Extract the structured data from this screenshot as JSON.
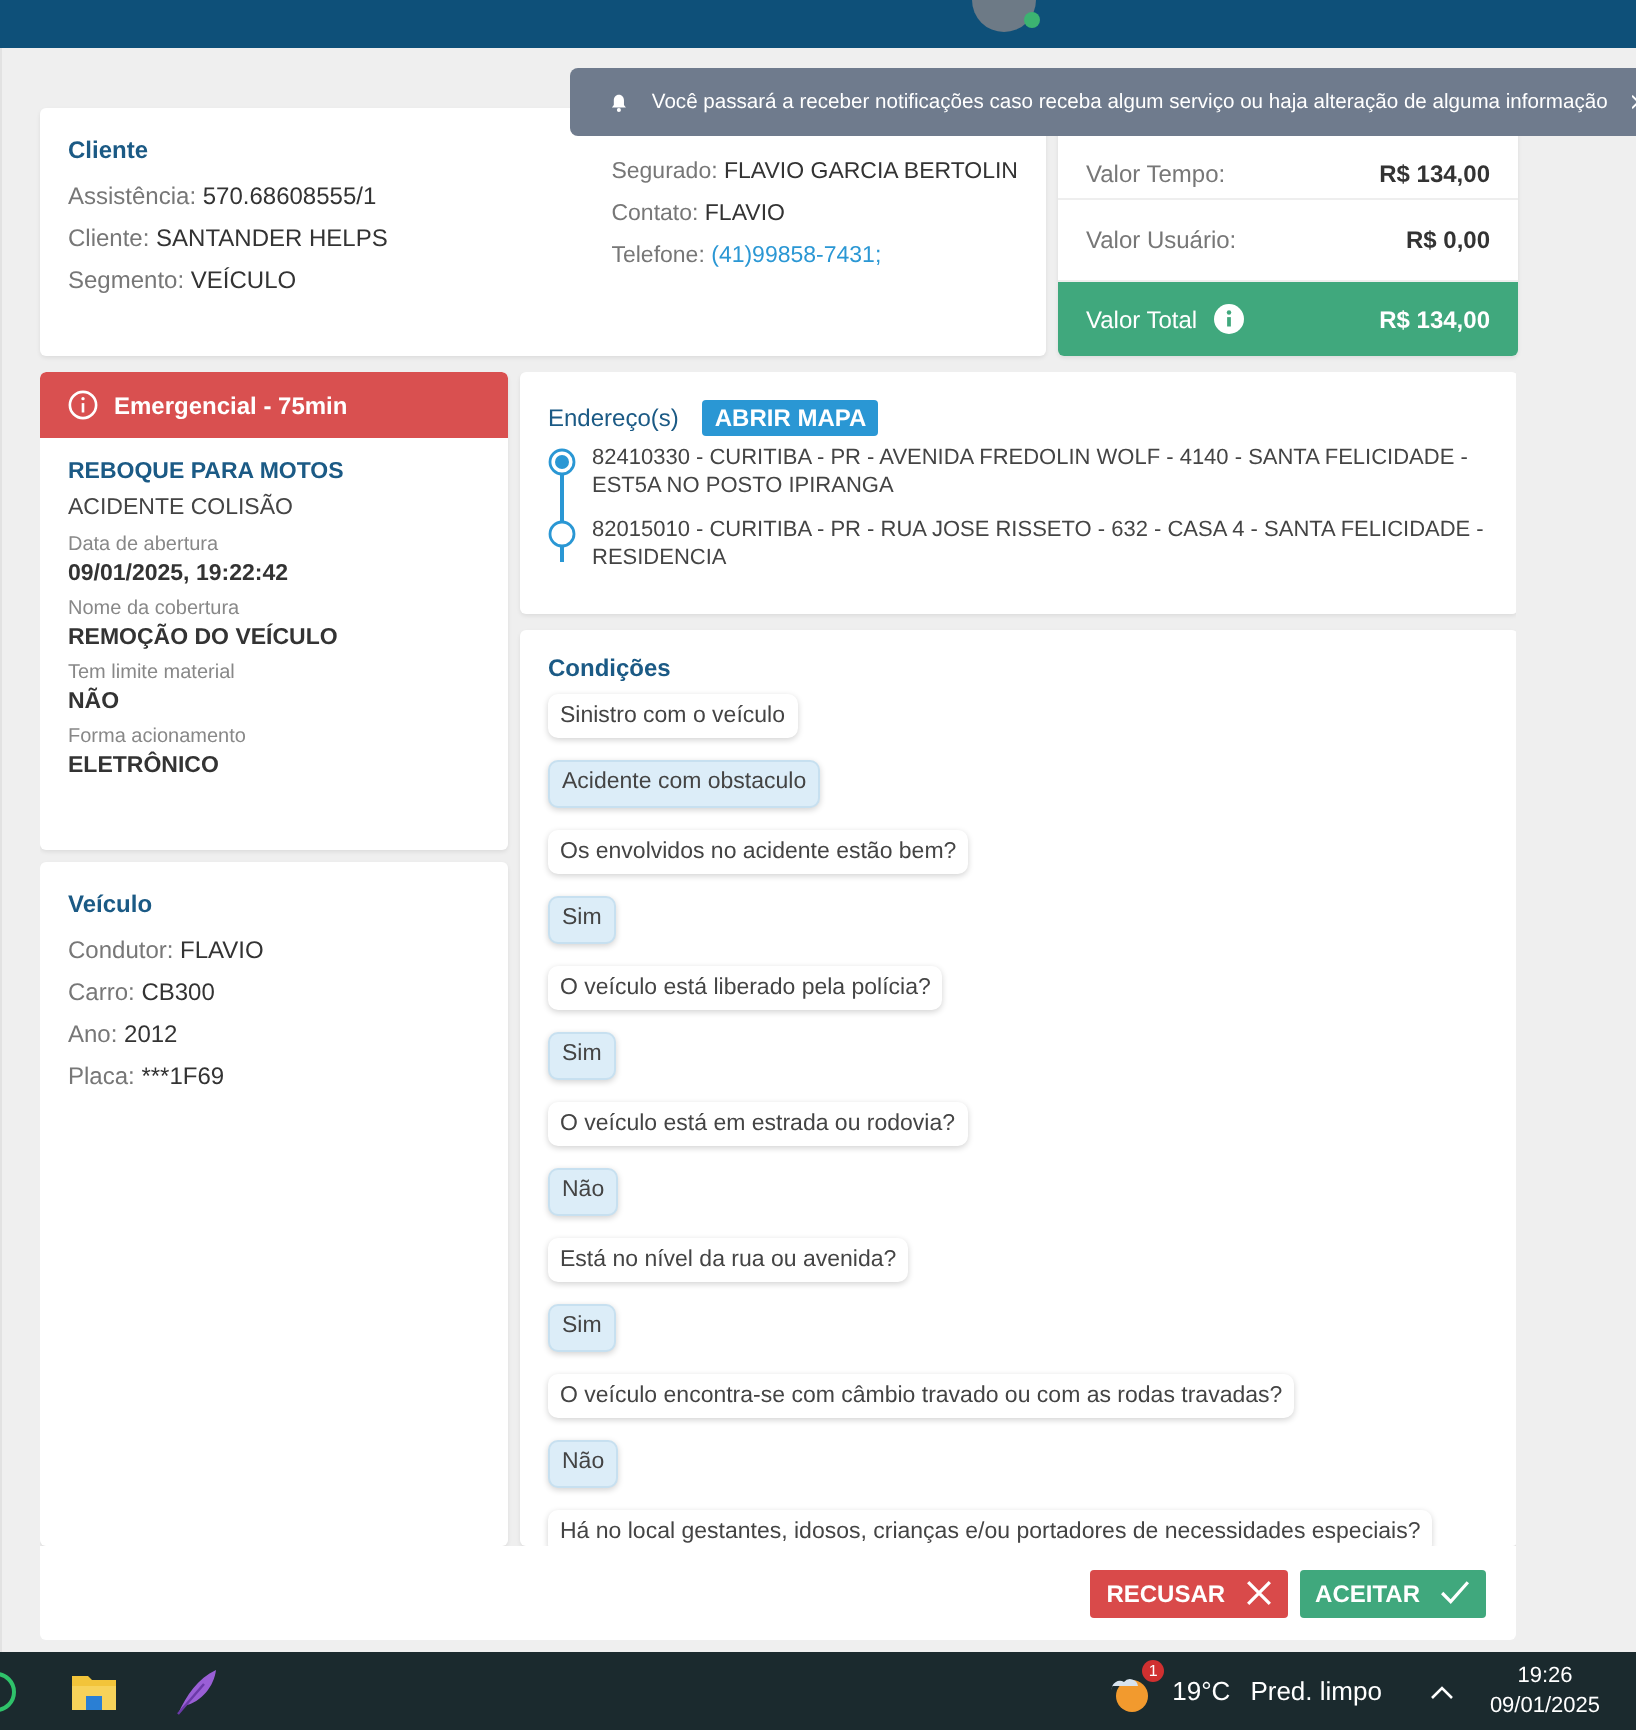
{
  "toast": {
    "message": "Você passará a receber notificações caso receba algum serviço ou haja alteração de alguma informação"
  },
  "client": {
    "title": "Cliente",
    "fields_left": [
      {
        "label": "Assistência:",
        "value": "570.68608555/1",
        "kind": "text"
      },
      {
        "label": "Cliente:",
        "value": "SANTANDER HELPS",
        "kind": "text"
      },
      {
        "label": "Segmento:",
        "value": "VEÍCULO",
        "kind": "text"
      }
    ],
    "fields_right": [
      {
        "label": "Segurado:",
        "value": "FLAVIO GARCIA BERTOLIN",
        "kind": "text"
      },
      {
        "label": "Contato:",
        "value": "FLAVIO",
        "kind": "text"
      },
      {
        "label": "Telefone:",
        "value": "(41)99858-7431;",
        "kind": "link"
      }
    ]
  },
  "values": {
    "rows": [
      {
        "label": "Valor Tempo:",
        "value": "R$ 134,00"
      },
      {
        "label": "Valor Usuário:",
        "value": "R$ 0,00"
      }
    ],
    "total": {
      "label": "Valor Total",
      "value": "R$ 134,00"
    }
  },
  "service": {
    "badge": "Emergencial - 75min",
    "title": "REBOQUE PARA MOTOS",
    "subtitle": "ACIDENTE COLISÃO",
    "details": [
      {
        "label": "Data de abertura",
        "value": "09/01/2025, 19:22:42"
      },
      {
        "label": "Nome da cobertura",
        "value": "REMOÇÃO DO VEÍCULO"
      },
      {
        "label": "Tem limite material",
        "value": "NÃO"
      },
      {
        "label": "Forma acionamento",
        "value": "ELETRÔNICO"
      }
    ]
  },
  "vehicle": {
    "title": "Veículo",
    "fields": [
      {
        "label": "Condutor:",
        "value": "FLAVIO"
      },
      {
        "label": "Carro:",
        "value": "CB300"
      },
      {
        "label": "Ano:",
        "value": "2012"
      },
      {
        "label": "Placa:",
        "value": "***1F69"
      }
    ]
  },
  "addresses": {
    "title": "Endereço(s)",
    "map_button": "ABRIR MAPA",
    "items": [
      {
        "text": "82410330 - CURITIBA - PR - AVENIDA FREDOLIN WOLF - 4140 - SANTA FELICIDADE - EST5A NO POSTO IPIRANGA",
        "kind": "origin"
      },
      {
        "text": "82015010 - CURITIBA - PR - RUA JOSE RISSETO - 632 - CASA 4 - SANTA FELICIDADE - RESIDENCIA",
        "kind": "destination"
      }
    ]
  },
  "conditions": {
    "title": "Condições",
    "items": [
      {
        "text": "Sinistro com o veículo",
        "kind": "question"
      },
      {
        "text": "Acidente com obstaculo",
        "kind": "answer"
      },
      {
        "text": "Os envolvidos no acidente estão bem?",
        "kind": "question"
      },
      {
        "text": "Sim",
        "kind": "answer"
      },
      {
        "text": "O veículo está liberado pela polícia?",
        "kind": "question"
      },
      {
        "text": "Sim",
        "kind": "answer"
      },
      {
        "text": "O veículo está em estrada ou rodovia?",
        "kind": "question"
      },
      {
        "text": "Não",
        "kind": "answer"
      },
      {
        "text": "Está no nível da rua ou avenida?",
        "kind": "question"
      },
      {
        "text": "Sim",
        "kind": "answer"
      },
      {
        "text": "O veículo encontra-se com câmbio travado ou com as rodas travadas?",
        "kind": "question"
      },
      {
        "text": "Não",
        "kind": "answer"
      },
      {
        "text": "Há no local gestantes, idosos, crianças e/ou portadores de necessidades especiais?",
        "kind": "question"
      }
    ]
  },
  "actions": [
    {
      "label": "RECUSAR",
      "kind": "reject"
    },
    {
      "label": "ACEITAR",
      "kind": "accept"
    }
  ],
  "taskbar": {
    "weather_badge": "1",
    "temperature": "19°C",
    "weather": "Pred. limpo",
    "time": "19:26",
    "date": "09/01/2025"
  }
}
